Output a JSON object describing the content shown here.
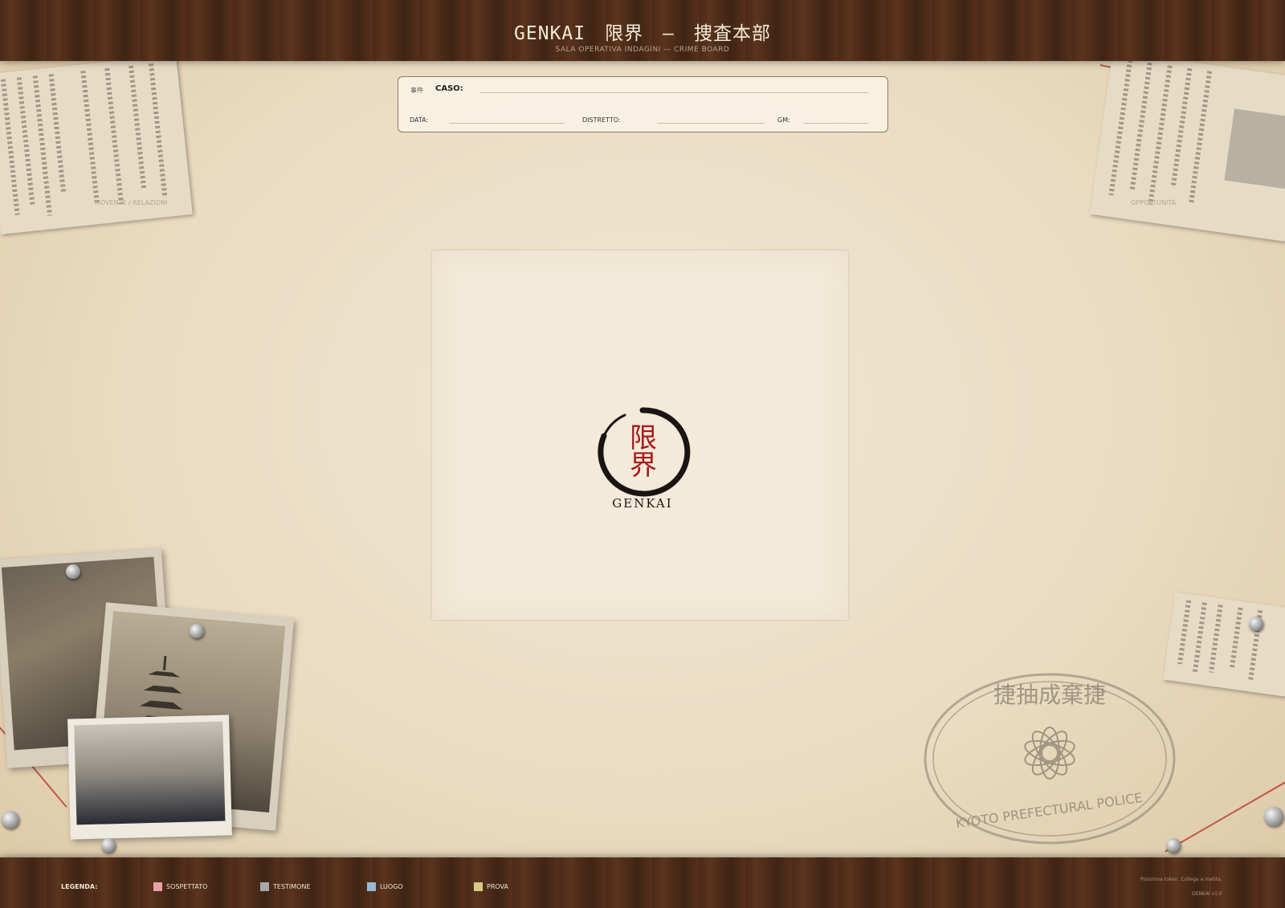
{
  "header": {
    "title": "GENKAI　限界　—　捜査本部",
    "subtitle": "SALA OPERATIVA INDAGINI  —  CRIME BOARD"
  },
  "case_form": {
    "kanji_label": "事件",
    "case_label": "CASO:",
    "date_label": "DATA:",
    "district_label": "DISTRETTO:",
    "gm_label": "GM:"
  },
  "board": {
    "left_zone_label": "MOVENTE / RELAZIONI",
    "right_zone_label": "OPPORTUNITÀ"
  },
  "logo": {
    "kanji_top": "限",
    "kanji_bottom": "界",
    "name": "GENKAI"
  },
  "stamp": {
    "text": "KYOTO PREFECTURAL POLICE",
    "kanji": "捷抽成棄捷"
  },
  "legend": {
    "title": "LEGENDA:",
    "items": [
      {
        "label": "SOSPETTATO",
        "color": "#e8a0a8"
      },
      {
        "label": "TESTIMONE",
        "color": "#a8a8a8"
      },
      {
        "label": "LUOGO",
        "color": "#9ab8d8"
      },
      {
        "label": "PROVA",
        "color": "#d8c88a"
      }
    ]
  },
  "footer": {
    "hint": "Posiziona token. Collega a matita.",
    "version": "GENKAI  v1.0"
  },
  "colors": {
    "wood": "#4a2a18",
    "string": "#b53a2a",
    "logo_red": "#a8191c"
  }
}
